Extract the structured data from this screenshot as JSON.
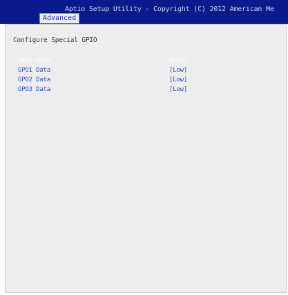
{
  "header": {
    "title": "Aptio Setup Utility - Copyright (C) 2012 American Me",
    "active_tab": "Advanced"
  },
  "section": {
    "title": "Configure Special GPIO"
  },
  "rows": [
    {
      "label": "GPO0 Data",
      "value": "[Low]"
    },
    {
      "label": "GPO1 Data",
      "value": "[Low]"
    },
    {
      "label": "GPO2 Data",
      "value": "[Low]"
    },
    {
      "label": "GPO3 Data",
      "value": "[Low]"
    }
  ],
  "colors": {
    "header_bg": "#0a1a8c",
    "option_text": "#2a4cc4",
    "selected_text": "#ffffff",
    "panel_bg": "#ededef"
  }
}
